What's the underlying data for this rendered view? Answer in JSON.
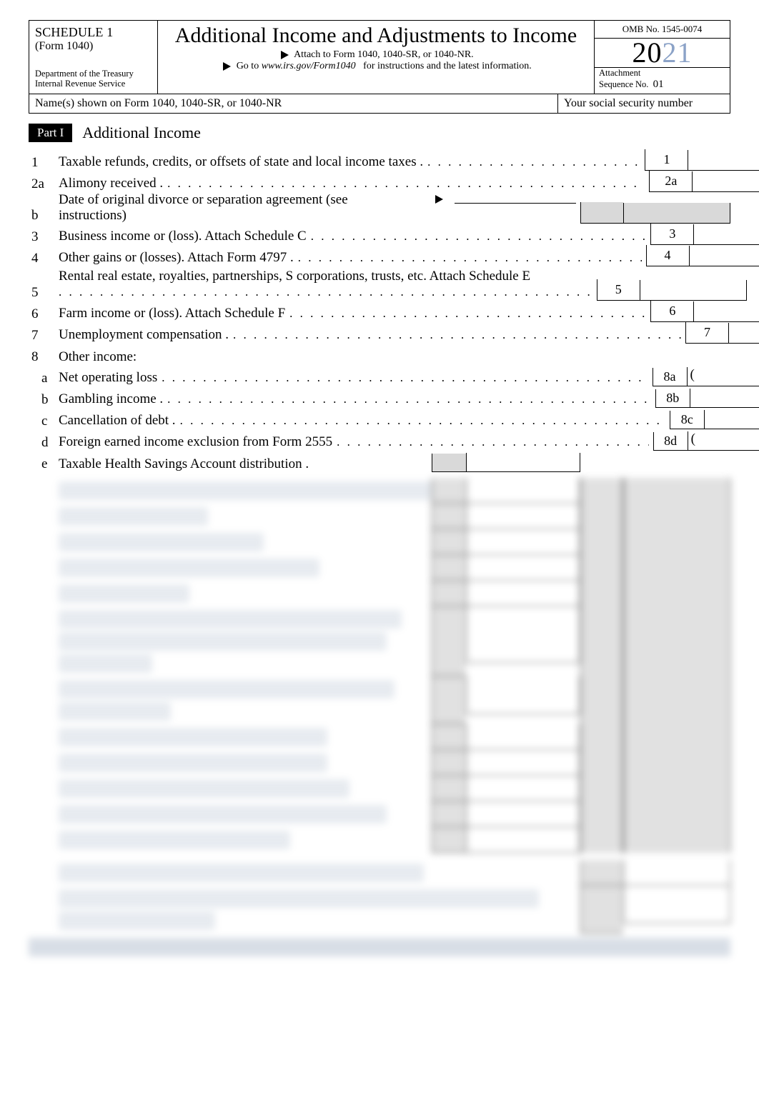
{
  "header": {
    "schedule": "SCHEDULE 1",
    "form_ref": "(Form 1040)",
    "department": "Department of the Treasury",
    "irs": "Internal Revenue Service",
    "title": "Additional Income and Adjustments to Income",
    "attach_to": "Attach to Form 1040, 1040-SR, or 1040-NR.",
    "goto_prefix": "Go to",
    "goto_site": "www.irs.gov/Form1040",
    "goto_suffix": "for instructions and the latest information.",
    "omb": "OMB No. 1545-0074",
    "year_a": "20",
    "year_b": "21",
    "att_label": "Attachment",
    "seq_label": "Sequence No.",
    "seq_no": "01",
    "names_label": "Name(s) shown on Form 1040, 1040-SR, or 1040-NR",
    "ssn_label": "Your social security number"
  },
  "part1": {
    "tag": "Part I",
    "title": "Additional Income"
  },
  "lines": {
    "l1": {
      "n": "1",
      "t": "Taxable refunds, credits, or offsets of state and local income taxes .",
      "rn": "1"
    },
    "l2a": {
      "n": "2a",
      "t": "Alimony received .",
      "rn": "2a"
    },
    "l2b": {
      "n": "b",
      "t": "Date of original divorce or separation agreement (see instructions)"
    },
    "l3": {
      "n": "3",
      "t": "Business income or (loss). Attach Schedule C",
      "rn": "3"
    },
    "l4": {
      "n": "4",
      "t": "Other gains or (losses). Attach Form 4797 .",
      "rn": "4"
    },
    "l5": {
      "n": "5",
      "t": "Rental real estate, royalties, partnerships, S corporations, trusts, etc. Attach Schedule E",
      "rn": "5"
    },
    "l6": {
      "n": "6",
      "t": "Farm income or (loss). Attach Schedule F",
      "rn": "6"
    },
    "l7": {
      "n": "7",
      "t": "Unemployment compensation .",
      "rn": "7"
    },
    "l8": {
      "n": "8",
      "t": "Other income:"
    },
    "l8a": {
      "n": "a",
      "t": "Net operating loss",
      "rn": "8a"
    },
    "l8b": {
      "n": "b",
      "t": "Gambling income .",
      "rn": "8b"
    },
    "l8c": {
      "n": "c",
      "t": "Cancellation of debt .",
      "rn": "8c"
    },
    "l8d": {
      "n": "d",
      "t": "Foreign earned income exclusion from Form 2555",
      "rn": "8d"
    },
    "l8e": {
      "n": "e",
      "t": "Taxable Health Savings Account distribution ."
    }
  }
}
